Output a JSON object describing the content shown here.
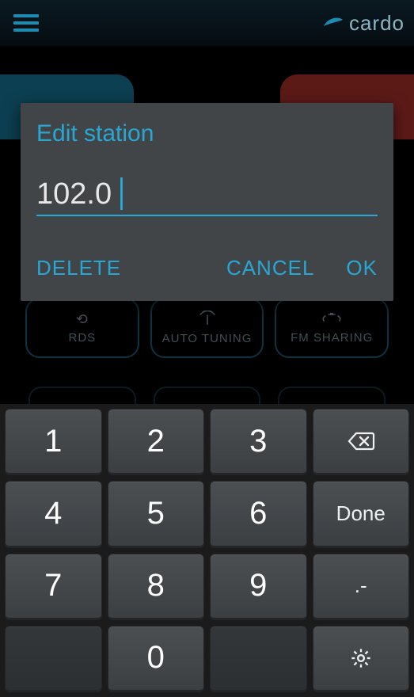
{
  "header": {
    "brand": "cardo"
  },
  "dialog": {
    "title": "Edit station",
    "value": "102.0",
    "delete": "DELETE",
    "cancel": "CANCEL",
    "ok": "OK"
  },
  "pills": {
    "rds": "RDS",
    "auto": "AUTO TUNING",
    "share": "FM SHARING"
  },
  "keypad": {
    "k1": "1",
    "k2": "2",
    "k3": "3",
    "k4": "4",
    "k5": "5",
    "k6": "6",
    "k7": "7",
    "k8": "8",
    "k9": "9",
    "k0": "0",
    "done": "Done",
    "dot": ".-"
  }
}
